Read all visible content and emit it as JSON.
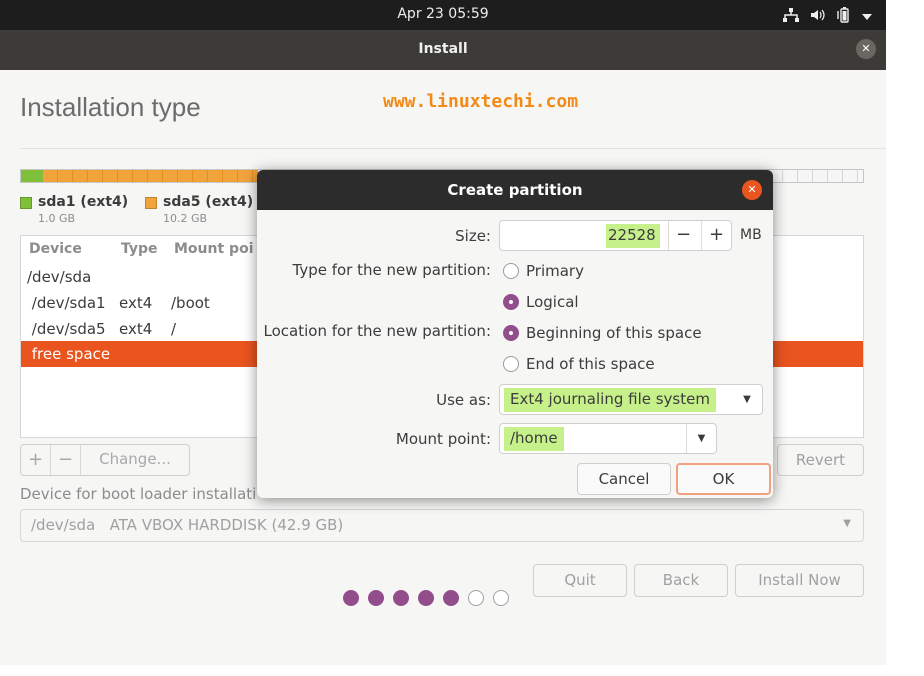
{
  "topbar": {
    "clock": "Apr 23  05:59"
  },
  "icons": {
    "network": "network-icon",
    "volume": "volume-icon",
    "battery": "battery-icon",
    "menu": "chevron-down-icon",
    "close": "close-icon",
    "dropdown": "caret-down-icon"
  },
  "window": {
    "title": "Install"
  },
  "page": {
    "heading": "Installation type",
    "watermark": "www.linuxtechi.com"
  },
  "legend": [
    {
      "name": "sda1 (ext4)",
      "size": "1.0 GB",
      "color": "#7fbf3a"
    },
    {
      "name": "sda5 (ext4)",
      "size": "10.2 GB",
      "color": "#f3a33c"
    }
  ],
  "table": {
    "headers": {
      "device": "Device",
      "type": "Type",
      "mount": "Mount poi"
    },
    "rows": [
      {
        "device": "/dev/sda",
        "type": "",
        "mount": ""
      },
      {
        "device": " /dev/sda1",
        "type": "ext4",
        "mount": "/boot"
      },
      {
        "device": " /dev/sda5",
        "type": "ext4",
        "mount": "/"
      },
      {
        "device": " free space",
        "type": "",
        "mount": ""
      }
    ]
  },
  "table_buttons": {
    "add": "+",
    "remove": "−",
    "change": "Change...",
    "revert": "Revert"
  },
  "bootloader": {
    "label": "Device for boot loader installati",
    "value": "/dev/sda   ATA VBOX HARDDISK (42.9 GB)"
  },
  "nav": {
    "quit": "Quit",
    "back": "Back",
    "install": "Install Now"
  },
  "progress": {
    "completed_steps": 5,
    "total_steps": 7
  },
  "dialog": {
    "title": "Create partition",
    "size_label": "Size:",
    "size_value": "22528",
    "size_minus": "−",
    "size_plus": "+",
    "unit": "MB",
    "type_label": "Type for the new partition:",
    "type_primary": "Primary",
    "type_logical": "Logical",
    "location_label": "Location for the new partition:",
    "location_begin": "Beginning of this space",
    "location_end": "End of this space",
    "useas_label": "Use as:",
    "useas_value": "Ext4 journaling file system",
    "mount_label": "Mount point:",
    "mount_value": "/home",
    "cancel": "Cancel",
    "ok": "OK"
  },
  "colors": {
    "accent": "#e9541f",
    "radio": "#924d8b",
    "highlight": "#c6f08a",
    "watermark": "#f28a17"
  }
}
